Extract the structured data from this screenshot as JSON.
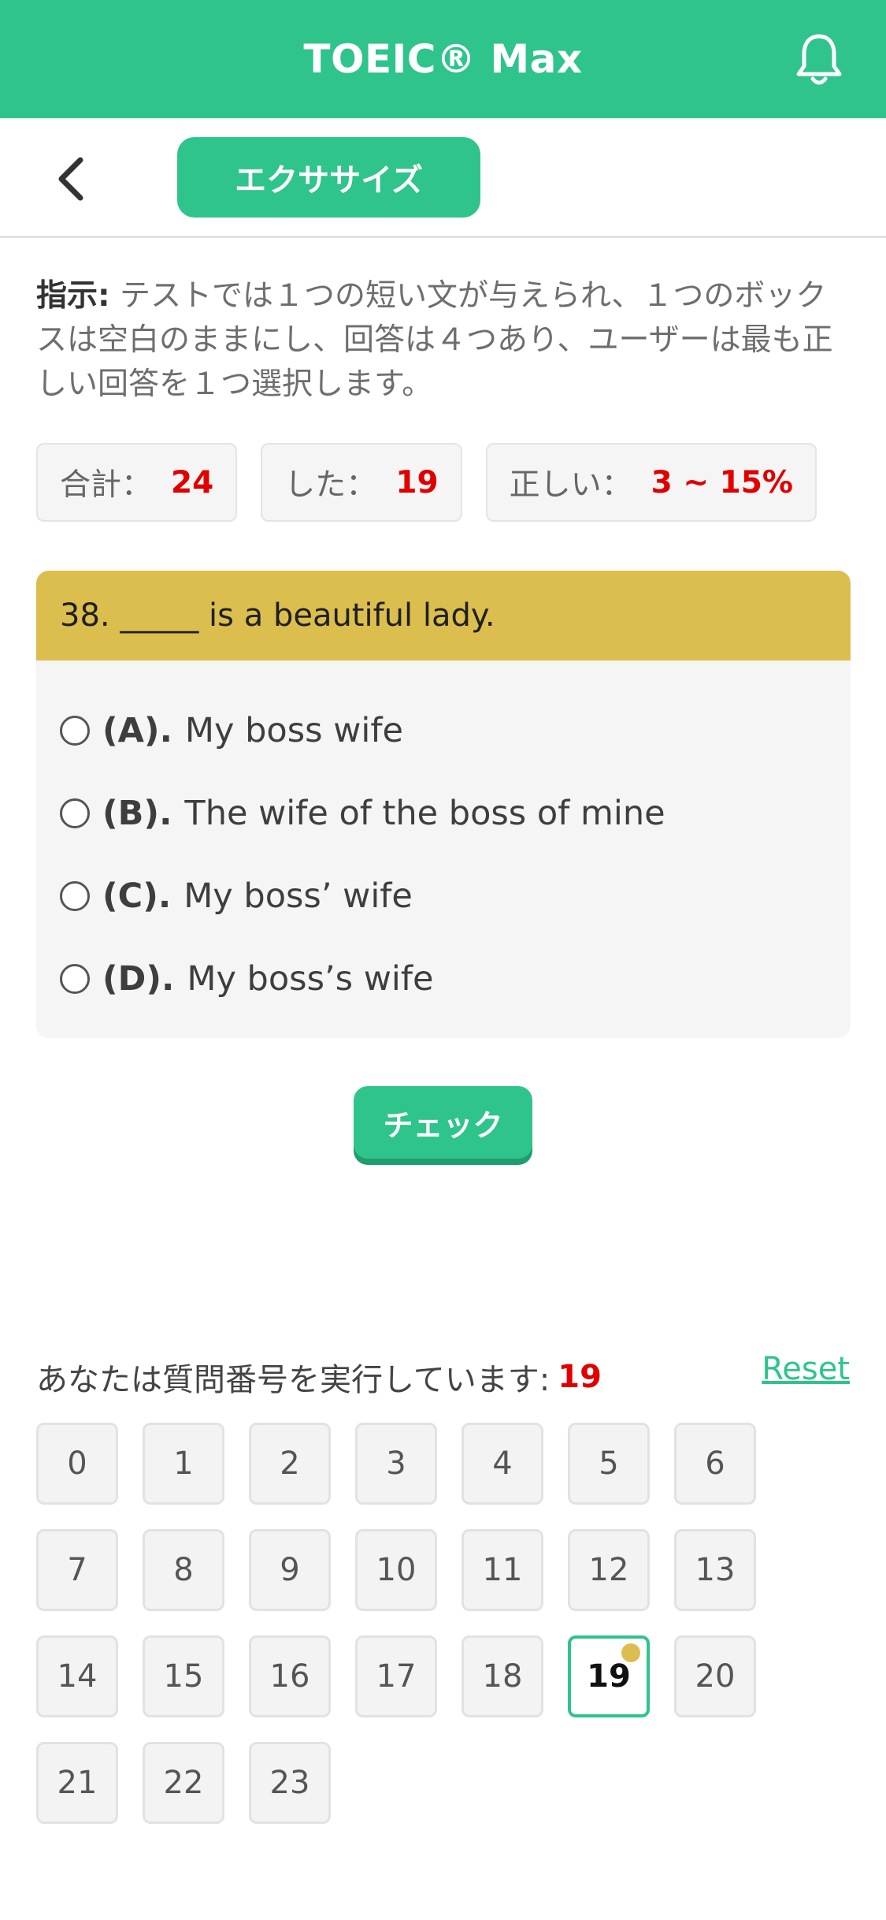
{
  "header": {
    "title": "TOEIC® Max"
  },
  "subheader": {
    "tab_label": "エクササイズ"
  },
  "instruction": {
    "label": "指示:",
    "text": " テストでは１つの短い文が与えられ、１つのボックスは空白のままにし、回答は４つあり、ユーザーは最も正しい回答を１つ選択します。"
  },
  "stats": {
    "total_label": "合計：",
    "total_value": "24",
    "done_label": "した：",
    "done_value": "19",
    "correct_label": "正しい：",
    "correct_value": "3 ~ 15%"
  },
  "question": {
    "text": "38. _____ is a beautiful lady.",
    "options": [
      {
        "letter": "(A).",
        "text": "My boss wife"
      },
      {
        "letter": "(B).",
        "text": "The wife of the boss of mine"
      },
      {
        "letter": "(C).",
        "text": "My boss’ wife"
      },
      {
        "letter": "(D).",
        "text": "My boss’s wife"
      }
    ]
  },
  "check_label": "チェック",
  "running": {
    "label": "あなたは質問番号を実行しています:",
    "current": "19"
  },
  "reset_label": "Reset",
  "numbers": [
    "0",
    "1",
    "2",
    "3",
    "4",
    "5",
    "6",
    "7",
    "8",
    "9",
    "10",
    "11",
    "12",
    "13",
    "14",
    "15",
    "16",
    "17",
    "18",
    "19",
    "20",
    "21",
    "22",
    "23"
  ],
  "colors": {
    "primary": "#2ec48b",
    "question_header": "#dcbe4e",
    "highlight": "#e00000"
  }
}
